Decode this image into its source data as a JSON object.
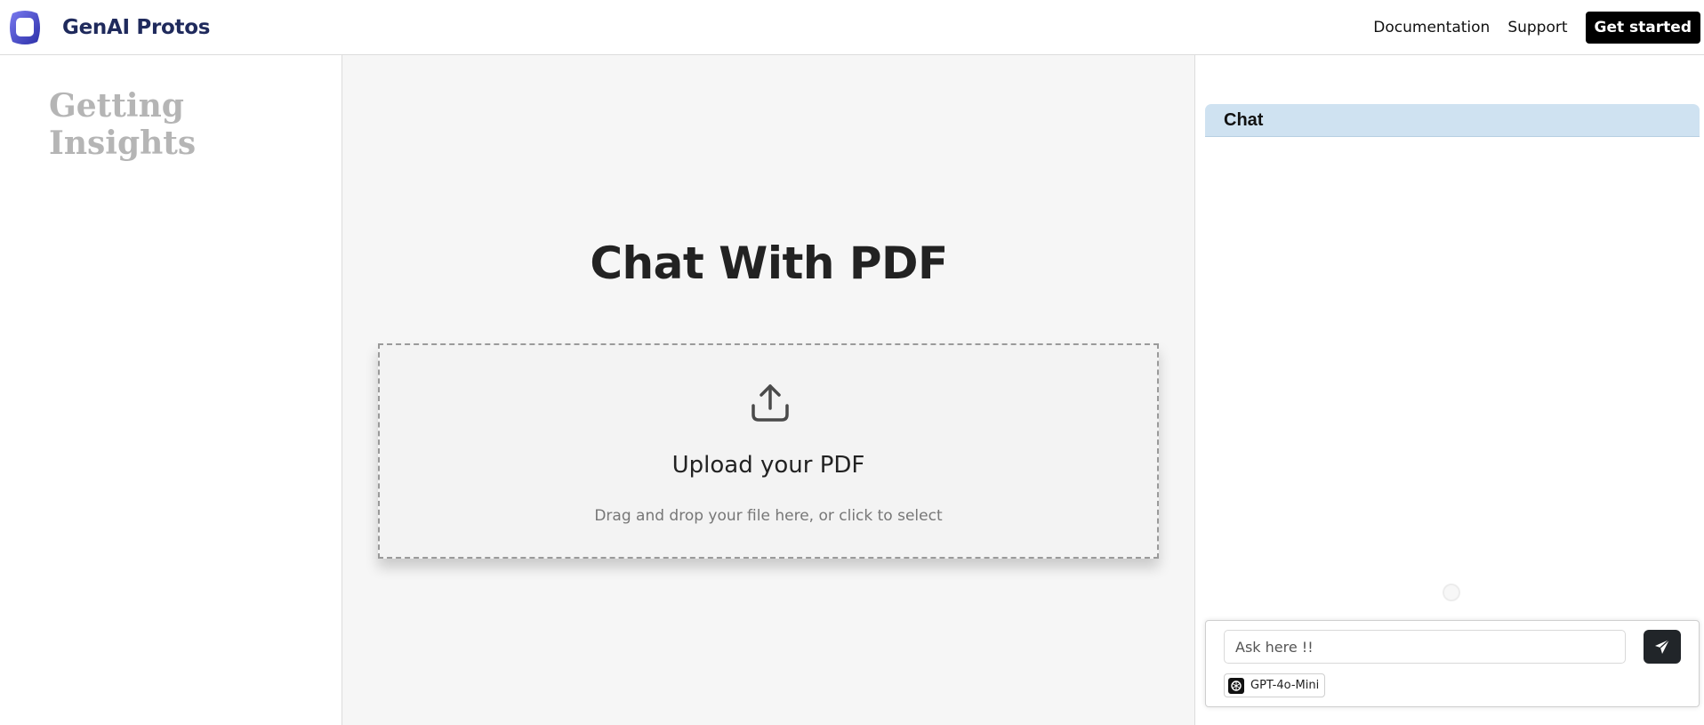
{
  "navbar": {
    "brand_text": "GenAI Protos",
    "links": [
      "Documentation",
      "Support"
    ],
    "cta_label": "Get started"
  },
  "left_panel": {
    "title": "Getting Insights"
  },
  "main": {
    "title": "Chat With PDF",
    "dropzone": {
      "title": "Upload your PDF",
      "subtitle": "Drag and drop your file here, or click to select"
    }
  },
  "chat": {
    "header": "Chat",
    "input_placeholder": "Ask here !!",
    "model_label": "GPT-4o-Mini"
  },
  "icons": {
    "logo": "genai-logo-icon",
    "upload": "upload-icon",
    "send": "paper-plane-icon",
    "model": "openai-icon"
  },
  "colors": {
    "chat_header_bg": "#cfe2f1",
    "cta_bg": "#000000",
    "brand_text": "#1f2a5c",
    "logo_accent": "#5b5bd6"
  }
}
